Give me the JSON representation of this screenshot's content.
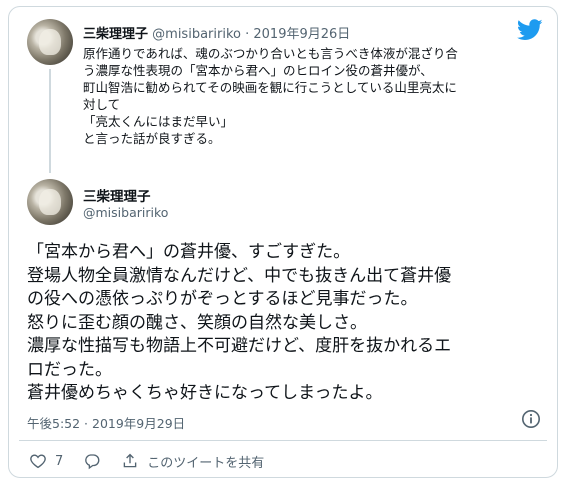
{
  "quoted_tweet": {
    "name": "三柴理理子",
    "handle": "@misibaririko",
    "date": "2019年9月26日",
    "separator": " · ",
    "lines": [
      "原作通りであれば、魂のぶつかり合いとも言うべき体液が混ざり合",
      "う濃厚な性表現の「宮本から君へ」のヒロイン役の蒼井優が、",
      "町山智浩に勧められてその映画を観に行こうとしている山里亮太に",
      "対して",
      "「亮太くんにはまだ早い」",
      "と言った話が良すぎる。"
    ]
  },
  "main_tweet": {
    "name": "三柴理理子",
    "handle": "@misibaririko",
    "lines": [
      "「宮本から君へ」の蒼井優、すごすぎた。",
      "登場人物全員激情なんだけど、中でも抜きん出て蒼井優",
      "の役への憑依っぷりがぞっとするほど見事だった。",
      "怒りに歪む顔の醜さ、笑顔の自然な美しさ。",
      "濃厚な性描写も物語上不可避だけど、度肝を抜かれるエ",
      "ロだった。",
      "蒼井優めちゃくちゃ好きになってしまったよ。"
    ],
    "timestamp": "午後5:52 · 2019年9月29日"
  },
  "actions": {
    "like_count": "7",
    "share_label": "このツイートを共有"
  },
  "icons": {
    "brand": "twitter-bird-icon",
    "info": "info-icon",
    "like": "heart-icon",
    "reply": "reply-bubble-icon",
    "share": "share-icon"
  },
  "colors": {
    "twitter_blue": "#1d9bf0",
    "secondary_text": "#536471",
    "border": "#cfd9de"
  }
}
